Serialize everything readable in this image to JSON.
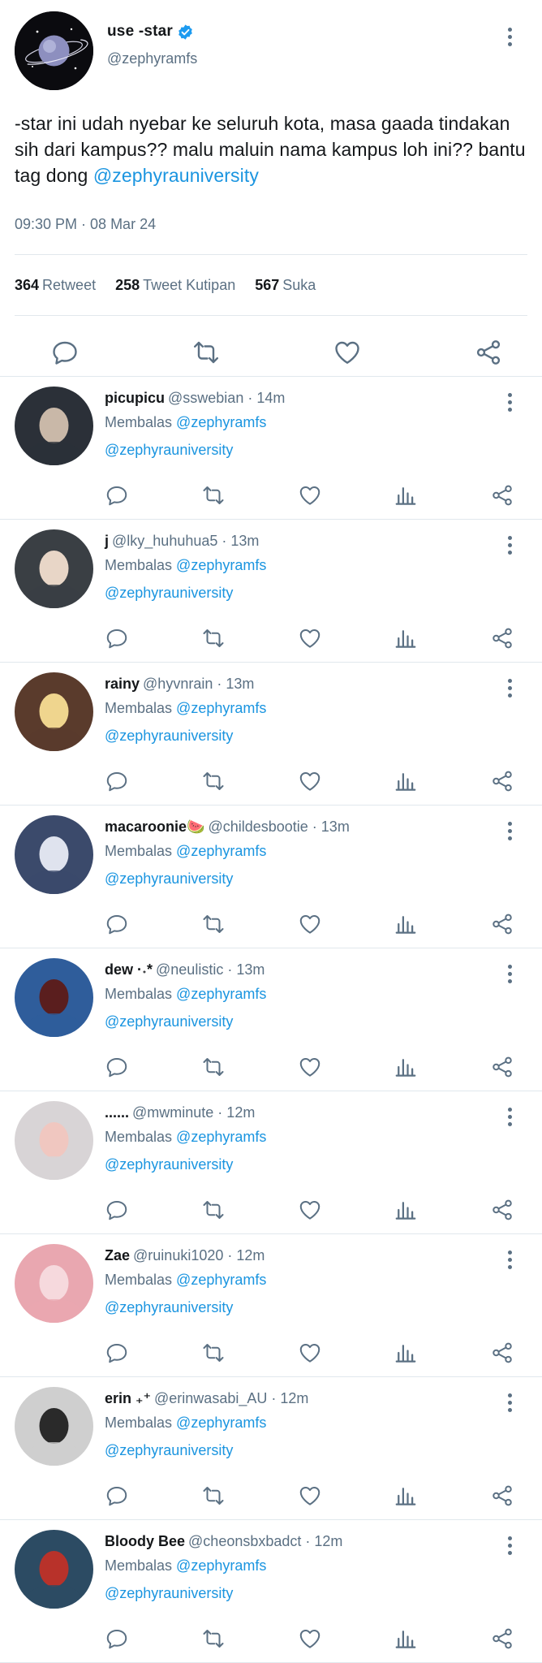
{
  "main_tweet": {
    "display_name": "use -star",
    "handle": "@zephyramfs",
    "text_before": "-star ini udah nyebar ke seluruh kota, masa gaada tindakan sih dari kampus?? malu maluin nama kampus loh ini?? bantu tag dong ",
    "mention": "@zephyrauniversity",
    "timestamp": "09:30 PM · 08 Mar 24",
    "stats": [
      {
        "count": "364",
        "label": "Retweet"
      },
      {
        "count": "258",
        "label": "Tweet Kutipan"
      },
      {
        "count": "567",
        "label": "Suka"
      }
    ],
    "icons": [
      "reply-icon",
      "retweet-icon",
      "like-icon",
      "share-icon"
    ]
  },
  "replying_prefix": "Membalas",
  "replying_to": "@zephyramfs",
  "replies": [
    {
      "name": "picupicu",
      "handle": "@sswebian",
      "time": "14m",
      "text": "@zephyrauniversity",
      "avatar_color": "#2b3038",
      "avatar_accent": "#c9b8a8"
    },
    {
      "name": "j",
      "handle": "@lky_huhuhua5",
      "time": "13m",
      "text": "@zephyrauniversity",
      "avatar_color": "#3a3f44",
      "avatar_accent": "#e8d6c7"
    },
    {
      "name": "rainy",
      "handle": "@hyvnrain",
      "time": "13m",
      "text": "@zephyrauniversity",
      "avatar_color": "#5a3b2c",
      "avatar_accent": "#efd58e"
    },
    {
      "name": "macaroonie🍉",
      "handle": "@childesbootie",
      "time": "13m",
      "text": "@zephyrauniversity",
      "avatar_color": "#3b4a6b",
      "avatar_accent": "#dfe3ee"
    },
    {
      "name": "dew ·˖*",
      "handle": "@neulistic",
      "time": "13m",
      "text": "@zephyrauniversity",
      "avatar_color": "#2f5d9b",
      "avatar_accent": "#5a1e1e"
    },
    {
      "name": "......",
      "handle": "@mwminute",
      "time": "12m",
      "text": "@zephyrauniversity",
      "avatar_color": "#d8d4d6",
      "avatar_accent": "#f0c7c0"
    },
    {
      "name": "Zae",
      "handle": "@ruinuki1020",
      "time": "12m",
      "text": "@zephyrauniversity",
      "avatar_color": "#e9a7b0",
      "avatar_accent": "#f6d9dd"
    },
    {
      "name": "erin ₊⁺",
      "handle": "@erinwasabi_AU",
      "time": "12m",
      "text": "@zephyrauniversity",
      "avatar_color": "#cfcfcf",
      "avatar_accent": "#2a2a2a"
    },
    {
      "name": "Bloody Bee",
      "handle": "@cheonsbxbadct",
      "time": "12m",
      "text": "@zephyrauniversity",
      "avatar_color": "#2c4b63",
      "avatar_accent": "#b8322a"
    }
  ],
  "reply_icons": [
    "reply-icon",
    "retweet-icon",
    "like-icon",
    "analytics-icon",
    "share-icon"
  ],
  "colors": {
    "accent": "#1b95e0",
    "verified": "#1d9bf0",
    "secondary_text": "#5b7083",
    "divider": "#e1e8ed"
  }
}
